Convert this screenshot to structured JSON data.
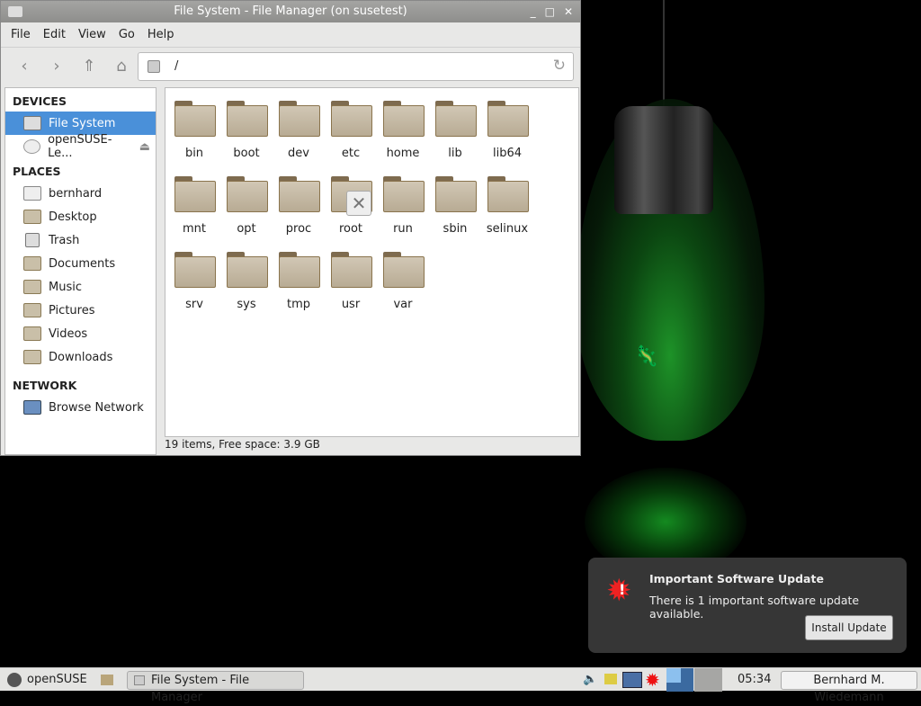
{
  "window": {
    "title": "File System - File Manager (on susetest)",
    "minimize": "_",
    "maximize": "□",
    "close": "✕"
  },
  "menu": [
    "File",
    "Edit",
    "View",
    "Go",
    "Help"
  ],
  "toolbar": {
    "back": "‹",
    "forward": "›",
    "up": "⇑",
    "home": "⌂",
    "location": "/",
    "reload": "↻"
  },
  "sidebar": {
    "devices_header": "DEVICES",
    "devices": [
      "File System",
      "openSUSE-Le..."
    ],
    "eject": "⏏",
    "places_header": "PLACES",
    "places": [
      "bernhard",
      "Desktop",
      "Trash",
      "Documents",
      "Music",
      "Pictures",
      "Videos",
      "Downloads"
    ],
    "network_header": "NETWORK",
    "network": [
      "Browse Network"
    ]
  },
  "files": [
    "bin",
    "boot",
    "dev",
    "etc",
    "home",
    "lib",
    "lib64",
    "mnt",
    "opt",
    "proc",
    "root",
    "run",
    "sbin",
    "selinux",
    "srv",
    "sys",
    "tmp",
    "usr",
    "var"
  ],
  "status": "19 items, Free space: 3.9 GB",
  "overlay_close": "✕",
  "notification": {
    "title": "Important Software Update",
    "message": "There is 1 important software update available.",
    "button": "Install Update",
    "icon": "!"
  },
  "taskbar": {
    "start": "openSUSE",
    "task": "File System - File Manager",
    "clock": "05:34",
    "user": "Bernhard M. Wiedemann"
  }
}
